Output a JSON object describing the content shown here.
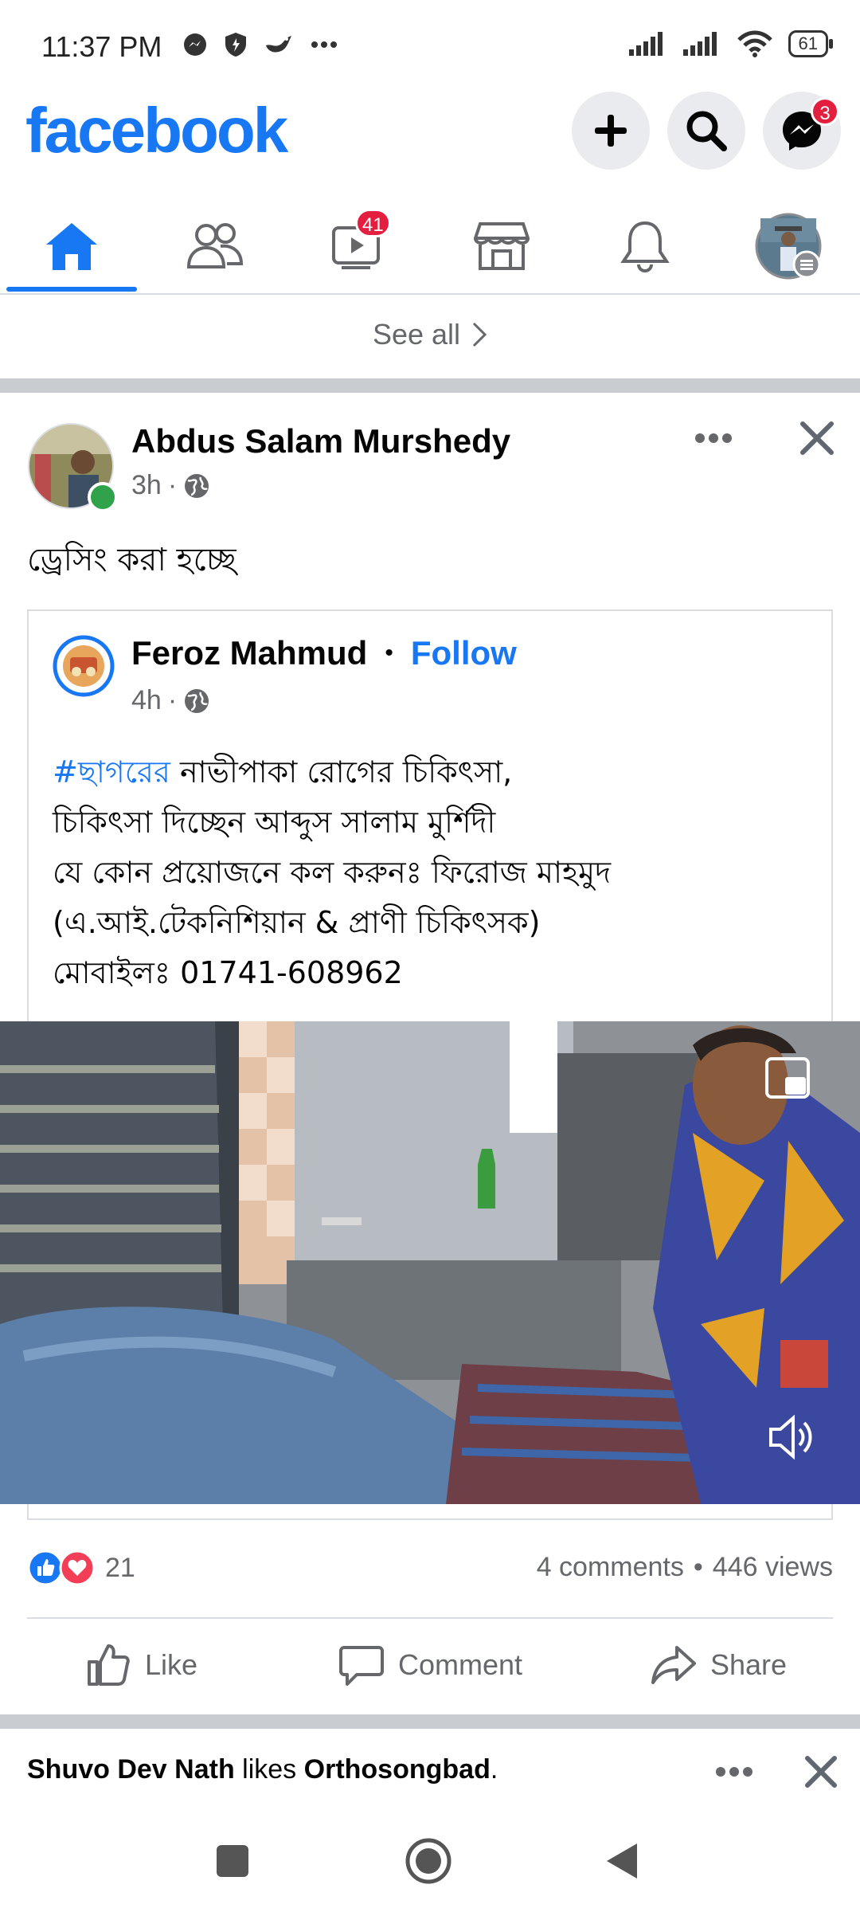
{
  "status_bar": {
    "time": "11:37 PM",
    "battery": "61"
  },
  "header": {
    "logo": "facebook",
    "messenger_badge": "3",
    "icons": [
      "plus-icon",
      "search-icon",
      "messenger-icon"
    ]
  },
  "tabs": {
    "watch_badge": "41",
    "items": [
      "home-icon",
      "friends-icon",
      "watch-icon",
      "marketplace-icon",
      "notifications-icon",
      "profile-menu"
    ]
  },
  "see_all": "See all",
  "post": {
    "author": "Abdus Salam Murshedy",
    "time": "3h",
    "dot": "·",
    "text": "ড্রেসিং করা হচ্ছে",
    "shared": {
      "author": "Feroz Mahmud",
      "separator": "•",
      "follow": "Follow",
      "time": "4h",
      "hashtag": "#ছাগরের",
      "line1_rest": " নাভীপাকা রোগের চিকিৎসা,",
      "line2": "চিকিৎসা দিচ্ছেন আব্দুস সালাম মুর্শিদী",
      "line3": "যে কোন প্রয়োজনে কল করুনঃ ফিরোজ মাহমুদ",
      "line4": "(এ.আই.টেকনিশিয়ান & প্রাণী চিকিৎসক)",
      "line5": "মোবাইলঃ 01741-608962"
    },
    "reactions_count": "21",
    "comments": "4 comments",
    "stats_separator": "•",
    "views": "446 views",
    "actions": {
      "like": "Like",
      "comment": "Comment",
      "share": "Share"
    }
  },
  "next_story": {
    "actor": "Shuvo Dev Nath",
    "verb": " likes ",
    "page": "Orthosongbad",
    "end": "."
  },
  "colors": {
    "brand": "#1877f2",
    "badge": "#e41e3f",
    "muted": "#65676b"
  }
}
